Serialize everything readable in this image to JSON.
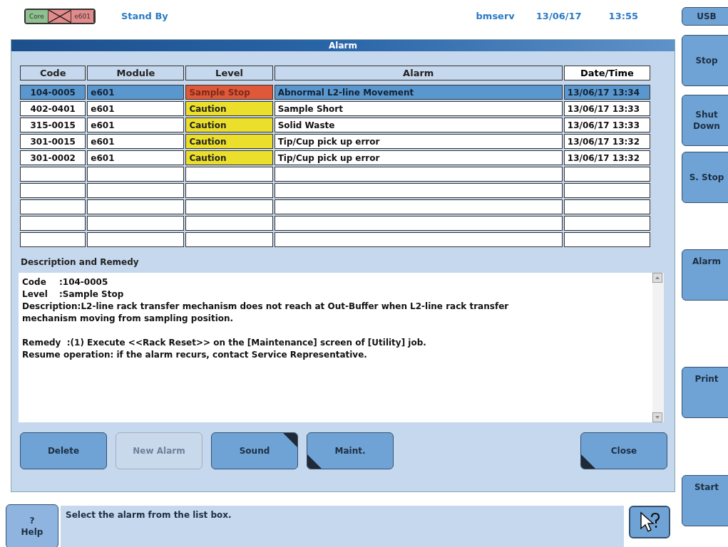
{
  "header": {
    "modules": [
      {
        "label": "Core",
        "crossed": false,
        "color": "#8fc08f"
      },
      {
        "crossed": true,
        "color": "#e48a8a"
      },
      {
        "label": "e601",
        "crossed": false,
        "color": "#e48a8a"
      }
    ],
    "status": "Stand By",
    "user": "bmserv",
    "date": "13/06/17",
    "time": "13:55"
  },
  "dialog": {
    "title": "Alarm",
    "table": {
      "columns": [
        {
          "label": "Code",
          "selected": false
        },
        {
          "label": "Module",
          "selected": false
        },
        {
          "label": "Level",
          "selected": false
        },
        {
          "label": "Alarm",
          "selected": false
        },
        {
          "label": "Date/Time",
          "selected": true
        }
      ],
      "rows": [
        {
          "code": "104-0005",
          "module": "e601",
          "level": "Sample Stop",
          "color": "#e0583a",
          "alarm": "Abnormal L2-line Movement",
          "datetime": "13/06/17 13:34",
          "selected": true
        },
        {
          "code": "402-0401",
          "module": "e601",
          "level": "Caution",
          "color": "#ecdf2c",
          "alarm": "Sample Short",
          "datetime": "13/06/17 13:33",
          "selected": false
        },
        {
          "code": "315-0015",
          "module": "e601",
          "level": "Caution",
          "color": "#ecdf2c",
          "alarm": "Solid Waste",
          "datetime": "13/06/17 13:33",
          "selected": false
        },
        {
          "code": "301-0015",
          "module": "e601",
          "level": "Caution",
          "color": "#ecdf2c",
          "alarm": "Tip/Cup pick up error",
          "datetime": "13/06/17 13:32",
          "selected": false
        },
        {
          "code": "301-0002",
          "module": "e601",
          "level": "Caution",
          "color": "#ecdf2c",
          "alarm": "Tip/Cup pick up error",
          "datetime": "13/06/17 13:32",
          "selected": false
        }
      ]
    },
    "description_heading": "Description and Remedy",
    "description": {
      "fields": [
        {
          "label": "Code",
          "value": ":104-0005"
        },
        {
          "label": "Level",
          "value": ":Sample Stop"
        }
      ],
      "paragraphs": [
        [
          "Description:L2-line rack transfer mechanism does not reach at Out-Buffer when L2-line rack transfer mechanism moving from sampling position."
        ],
        [
          "Remedy  :(1) Execute <<Rack Reset>> on the [Maintenance] screen of [Utility] job.",
          "Resume operation: if the alarm recurs, contact Service Representative."
        ]
      ]
    },
    "buttons": [
      {
        "label": "Delete",
        "disabled": false,
        "kind": "plain"
      },
      {
        "label": "New Alarm",
        "disabled": true,
        "kind": "plain"
      },
      {
        "label": "Sound",
        "disabled": false,
        "kind": "flagged"
      },
      {
        "label": "Maint.",
        "disabled": false,
        "kind": "notched"
      },
      {
        "label": "Close",
        "disabled": false,
        "kind": "notched"
      }
    ]
  },
  "side_buttons": [
    {
      "label": "USB",
      "kind": "small"
    },
    {
      "label": "Stop",
      "kind": "large"
    },
    {
      "label": "Shut Down",
      "kind": "large"
    },
    {
      "label": "S. Stop",
      "kind": "large"
    },
    {
      "label": "Alarm",
      "kind": "large"
    },
    {
      "label": "Print",
      "kind": "large"
    },
    {
      "label": "Start",
      "kind": "large"
    }
  ],
  "footer": {
    "help_mark": "?",
    "help_label": "Help",
    "message": "Select the alarm from the list box."
  }
}
